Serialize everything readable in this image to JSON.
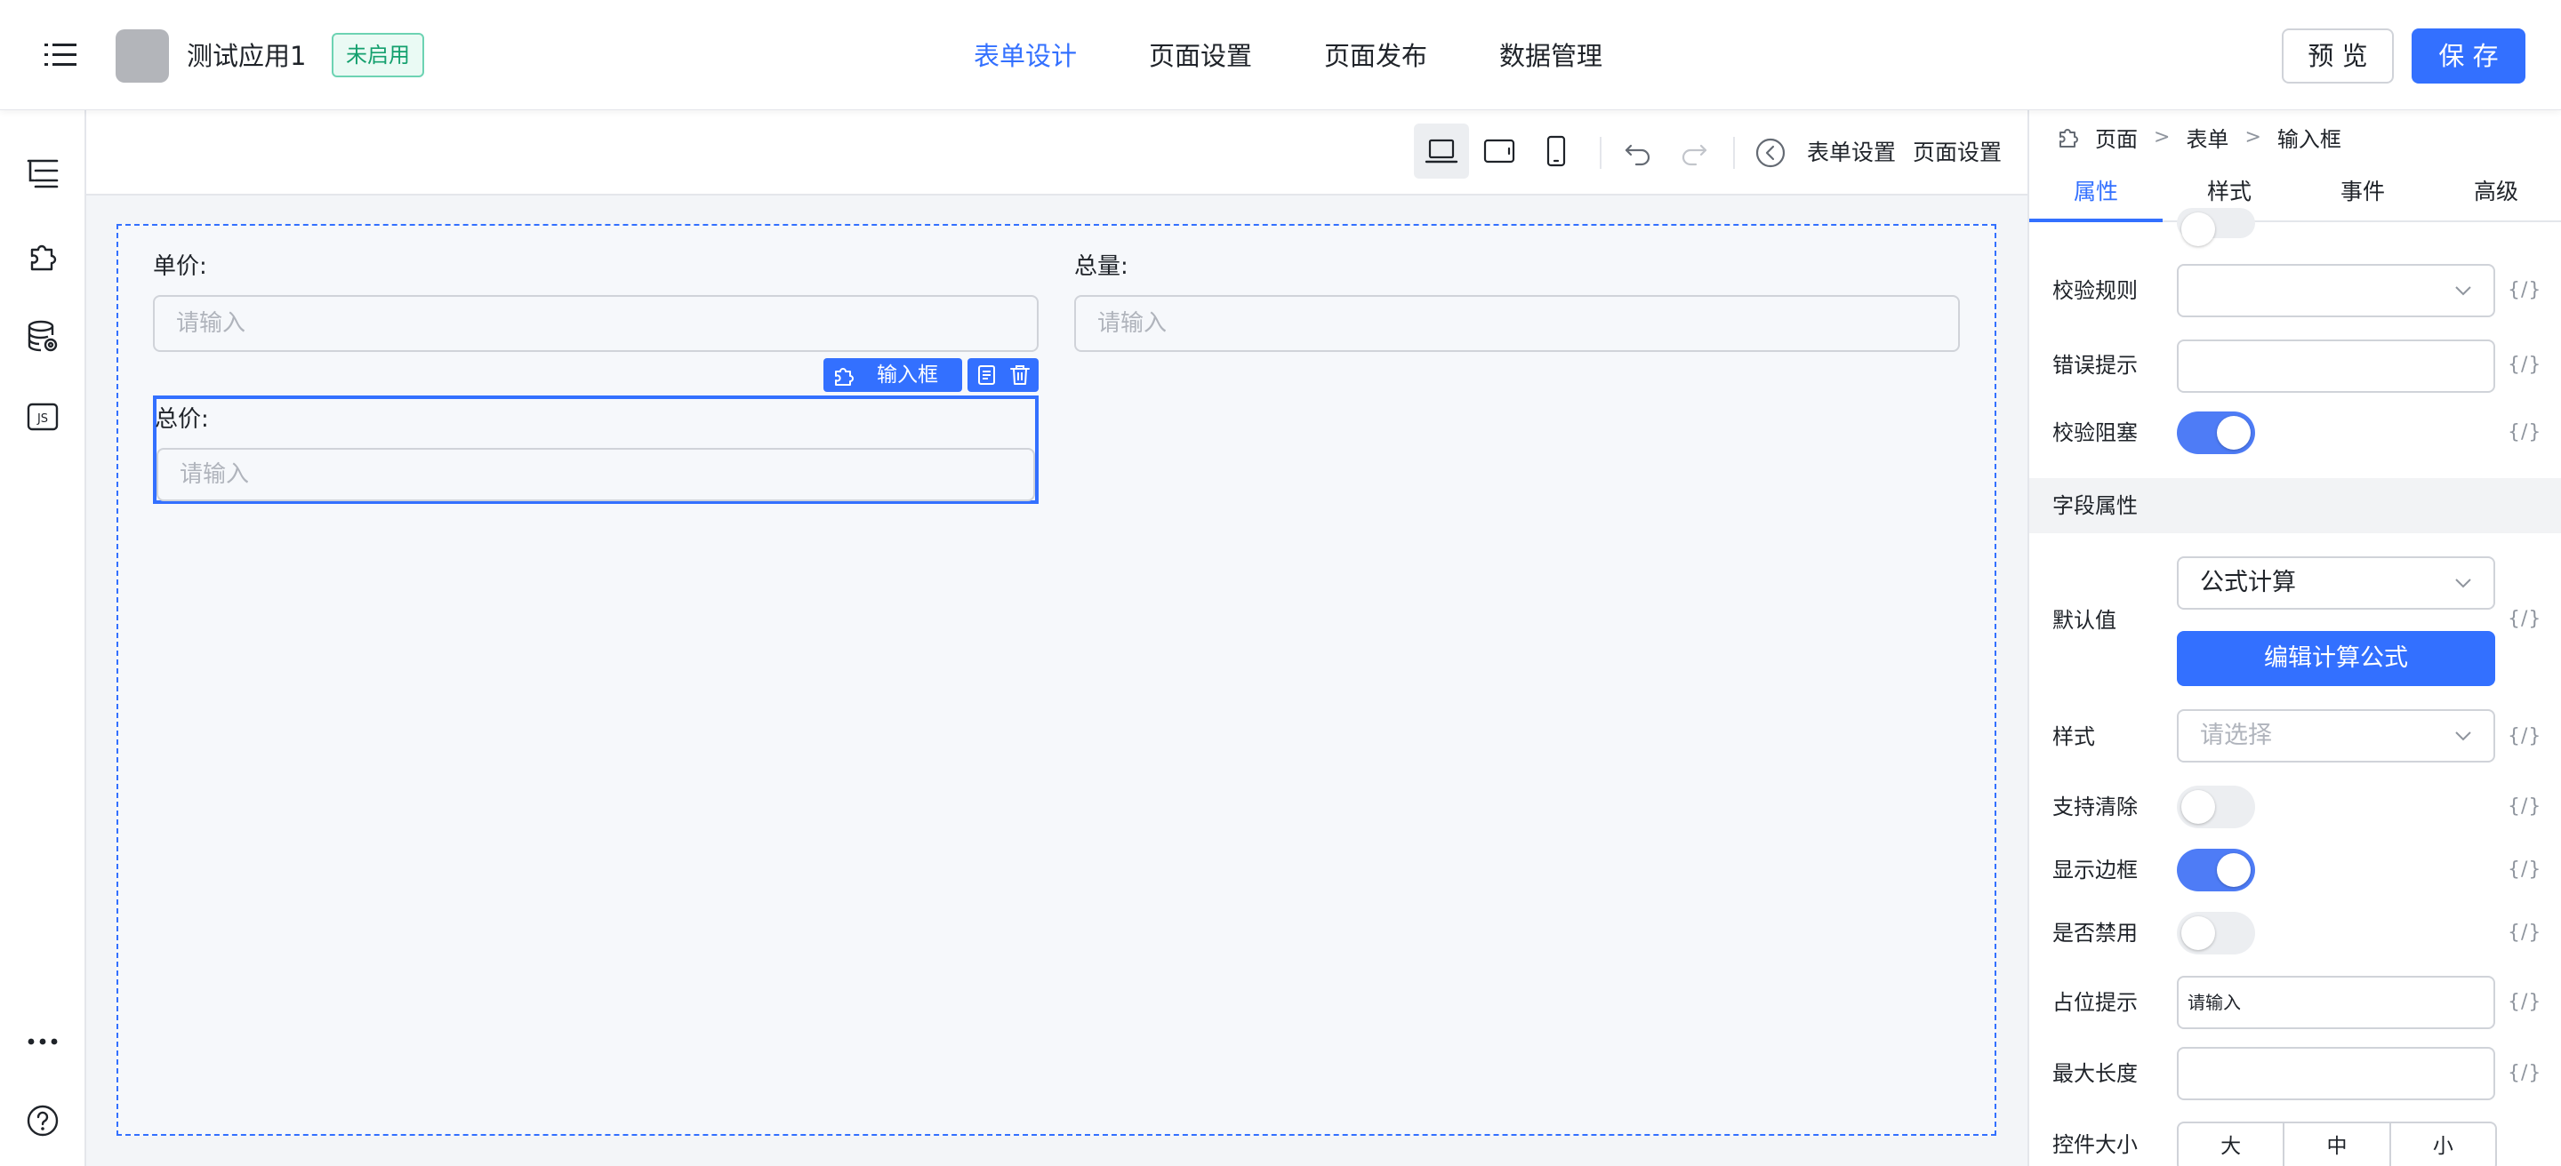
{
  "header": {
    "app_name": "测试应用1",
    "status_badge": "未启用",
    "nav_tabs": [
      {
        "label": "表单设计",
        "active": true
      },
      {
        "label": "页面设置",
        "active": false
      },
      {
        "label": "页面发布",
        "active": false
      },
      {
        "label": "数据管理",
        "active": false
      }
    ],
    "preview_label": "预 览",
    "save_label": "保 存"
  },
  "toolbar": {
    "form_settings": "表单设置",
    "page_settings": "页面设置"
  },
  "canvas": {
    "fields": [
      {
        "label": "单价:",
        "placeholder": "请输入"
      },
      {
        "label": "总量:",
        "placeholder": "请输入"
      },
      {
        "label": "总价:",
        "placeholder": "请输入"
      }
    ],
    "selected_chip": "输入框"
  },
  "panel": {
    "breadcrumb": [
      "页面",
      "表单",
      "输入框"
    ],
    "tabs": [
      "属性",
      "样式",
      "事件",
      "高级"
    ],
    "expr_symbol": "{/}",
    "validation_rule_label": "校验规则",
    "error_tip_label": "错误提示",
    "validation_block_label": "校验阻塞",
    "field_section": "字段属性",
    "default_value_label": "默认值",
    "default_value_selected": "公式计算",
    "edit_formula_button": "编辑计算公式",
    "style_label": "样式",
    "style_placeholder": "请选择",
    "clearable_label": "支持清除",
    "show_border_label": "显示边框",
    "disabled_label": "是否禁用",
    "placeholder_label": "占位提示",
    "placeholder_value": "请输入",
    "max_length_label": "最大长度",
    "size_label": "控件大小",
    "size_options": [
      "大",
      "中",
      "小"
    ]
  },
  "colors": {
    "accent": "#3370ff",
    "toggle_on": "#4e7cf6",
    "badge_text": "#14a06e"
  }
}
